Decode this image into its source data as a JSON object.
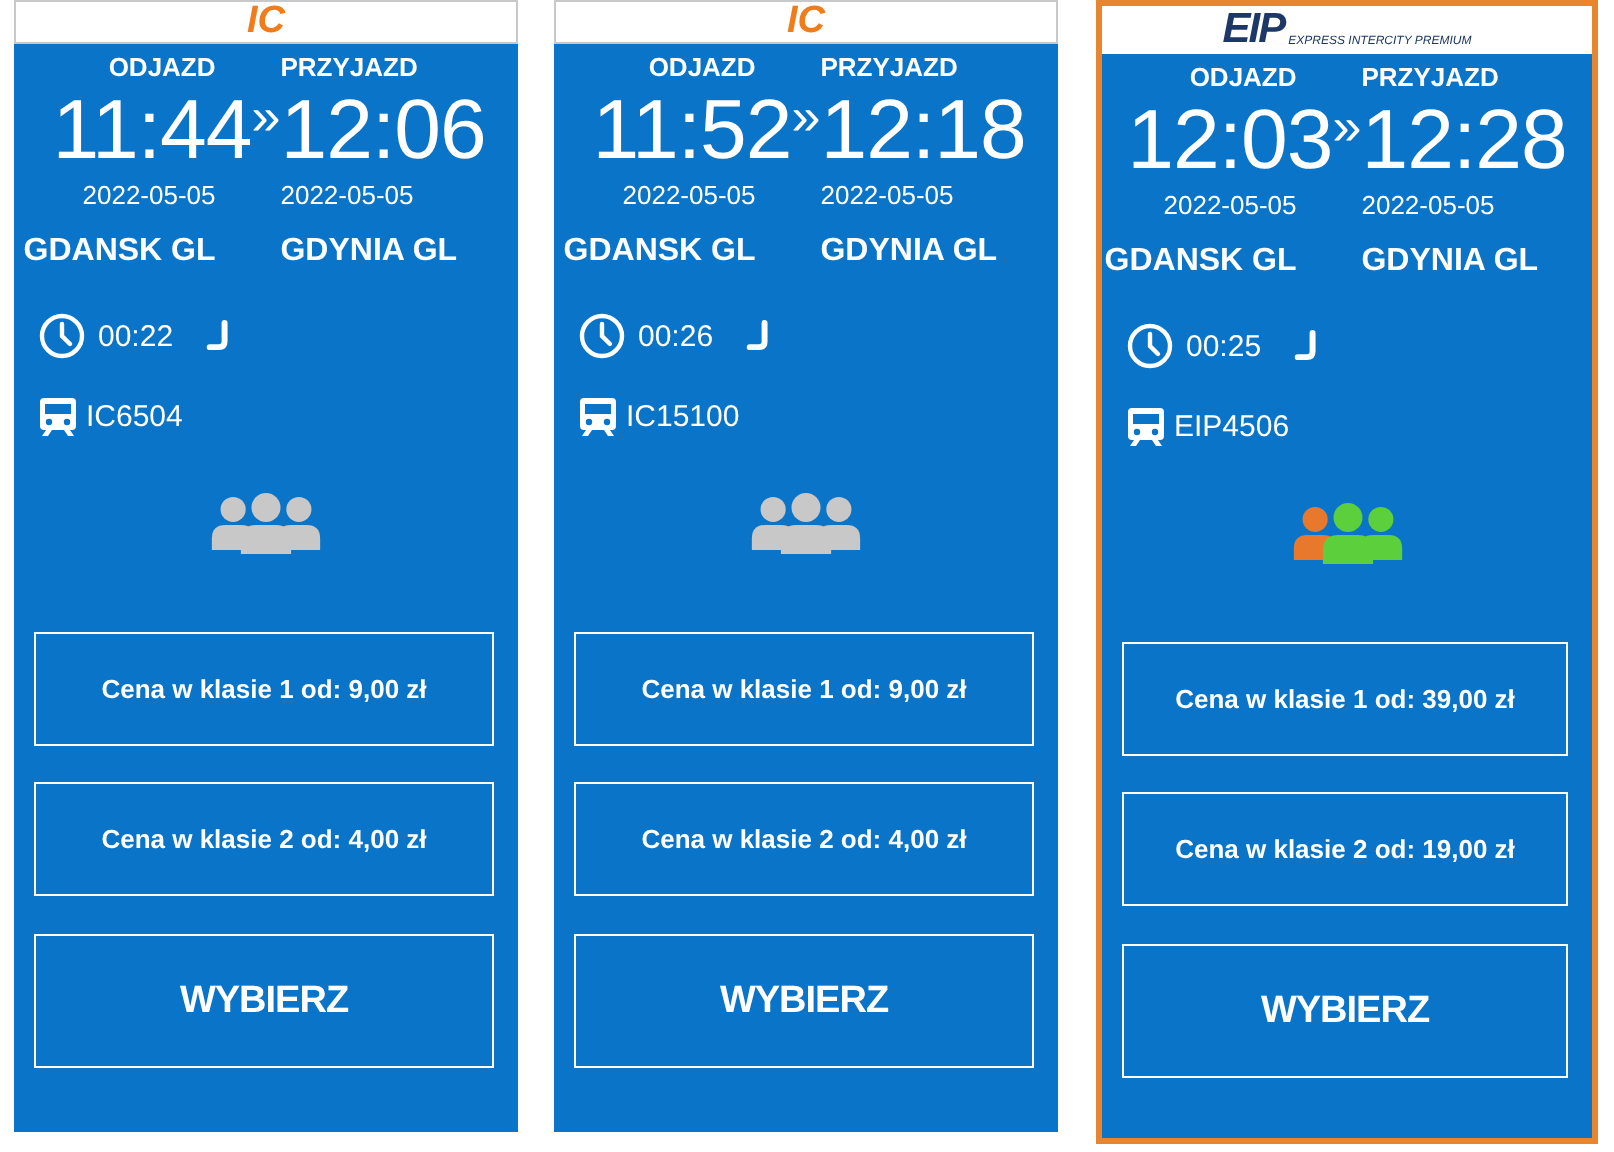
{
  "cards": [
    {
      "selected": false,
      "logo": {
        "kind": "ic",
        "text": "IC"
      },
      "departure_label": "ODJAZD",
      "arrival_label": "PRZYJAZD",
      "departure_time": "11:44",
      "separator": "»",
      "arrival_time": "12:06",
      "departure_date": "2022-05-05",
      "arrival_date": "2022-05-05",
      "from": "GDANSK GL",
      "to": "GDYNIA GL",
      "duration": "00:22",
      "train": "IC6504",
      "occupancy_known": false,
      "prices": [
        "Cena w klasie 1 od: 9,00 zł",
        "Cena w klasie 2 od: 4,00 zł"
      ],
      "button": "WYBIERZ"
    },
    {
      "selected": false,
      "logo": {
        "kind": "ic",
        "text": "IC"
      },
      "departure_label": "ODJAZD",
      "arrival_label": "PRZYJAZD",
      "departure_time": "11:52",
      "separator": "»",
      "arrival_time": "12:18",
      "departure_date": "2022-05-05",
      "arrival_date": "2022-05-05",
      "from": "GDANSK GL",
      "to": "GDYNIA GL",
      "duration": "00:26",
      "train": "IC15100",
      "occupancy_known": false,
      "prices": [
        "Cena w klasie 1 od: 9,00 zł",
        "Cena w klasie 2 od: 4,00 zł"
      ],
      "button": "WYBIERZ"
    },
    {
      "selected": true,
      "logo": {
        "kind": "eip",
        "text": "EIP",
        "tagline": "EXPRESS INTERCITY PREMIUM"
      },
      "departure_label": "ODJAZD",
      "arrival_label": "PRZYJAZD",
      "departure_time": "12:03",
      "separator": "»",
      "arrival_time": "12:28",
      "departure_date": "2022-05-05",
      "arrival_date": "2022-05-05",
      "from": "GDANSK GL",
      "to": "GDYNIA GL",
      "duration": "00:25",
      "train": "EIP4506",
      "occupancy_known": true,
      "prices": [
        "Cena w klasie 1 od: 39,00 zł",
        "Cena w klasie 2 od: 19,00 zł"
      ],
      "button": "WYBIERZ"
    }
  ]
}
